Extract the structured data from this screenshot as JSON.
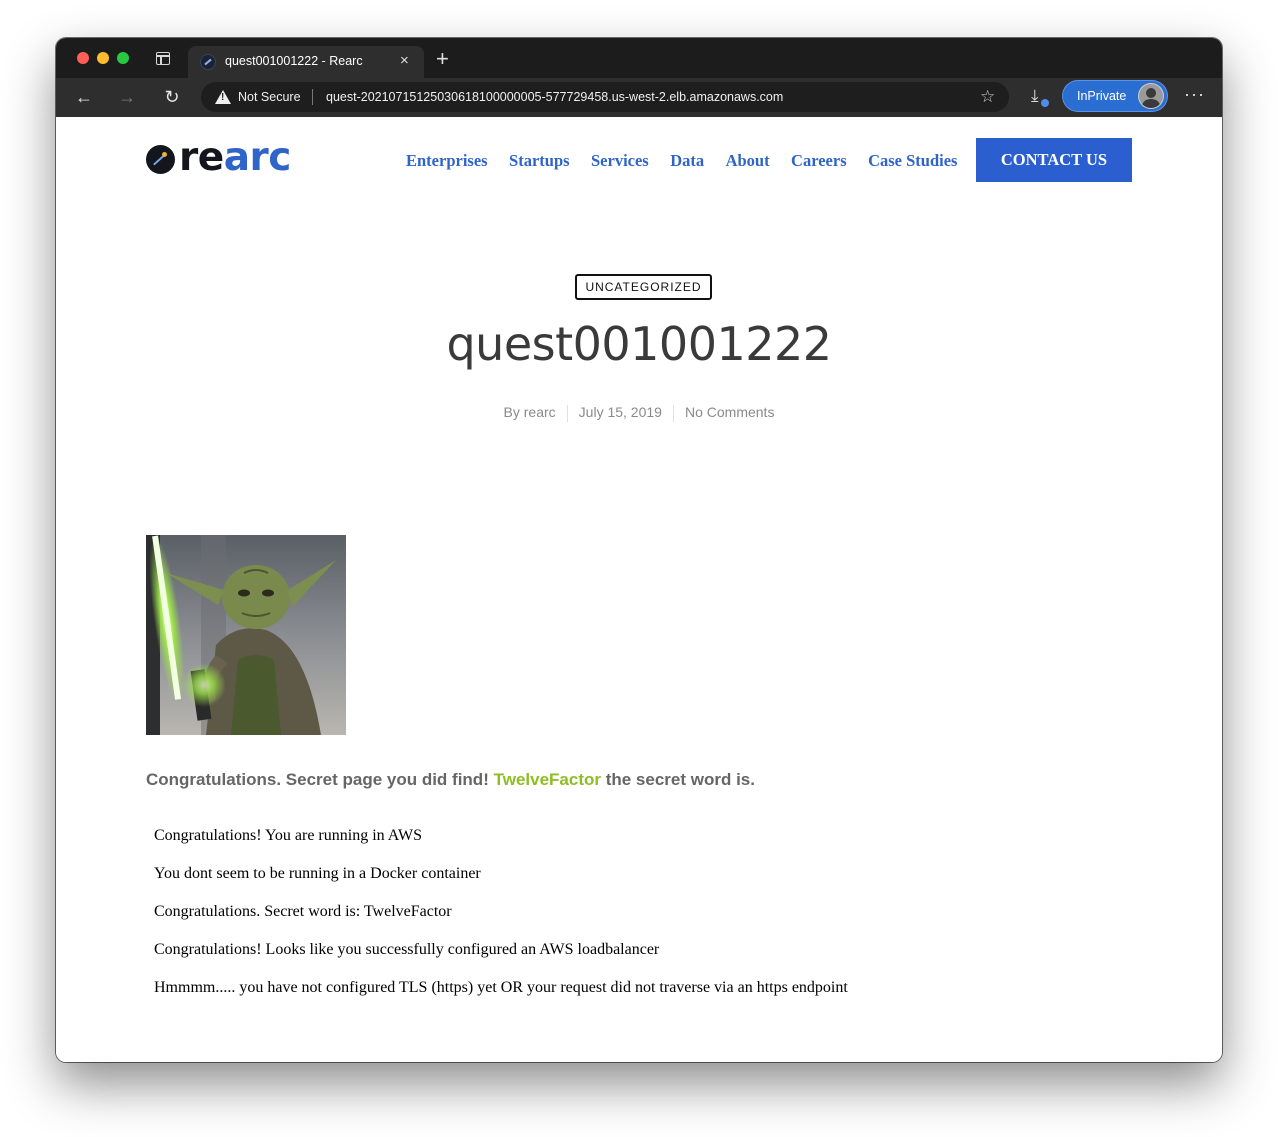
{
  "browser": {
    "tab_title": "quest001001222 - Rearc",
    "tab_close": "×",
    "new_tab": "+",
    "security_label": "Not Secure",
    "url": "quest-20210715125030618100000005-577729458.us-west-2.elb.amazonaws.com",
    "back": "←",
    "forward": "→",
    "refresh": "↻",
    "favorite": "☆",
    "download": "⤓",
    "profile_label": "InPrivate",
    "more": "···"
  },
  "site": {
    "logo_prefix": "re",
    "logo_suffix": "arc",
    "nav": [
      "Enterprises",
      "Startups",
      "Services",
      "Data",
      "About",
      "Careers",
      "Case Studies"
    ],
    "contact_label": "CONTACT US",
    "brand_color": "#2f64c8",
    "accent_green": "#8fbe24"
  },
  "post": {
    "category": "UNCATEGORIZED",
    "title": "quest001001222",
    "author": "By rearc",
    "date": "July 15, 2019",
    "comments": "No Comments",
    "secret_prefix": "Congratulations. Secret page you did find! ",
    "secret_word": "TwelveFactor",
    "secret_suffix": " the secret word is."
  },
  "results": [
    "Congratulations! You are running in AWS",
    "You dont seem to be running in a Docker container",
    "Congratulations. Secret word is: TwelveFactor",
    "Congratulations! Looks like you successfully configured an AWS loadbalancer",
    "Hmmmm..... you have not configured TLS (https) yet OR your request did not traverse via an https endpoint"
  ]
}
